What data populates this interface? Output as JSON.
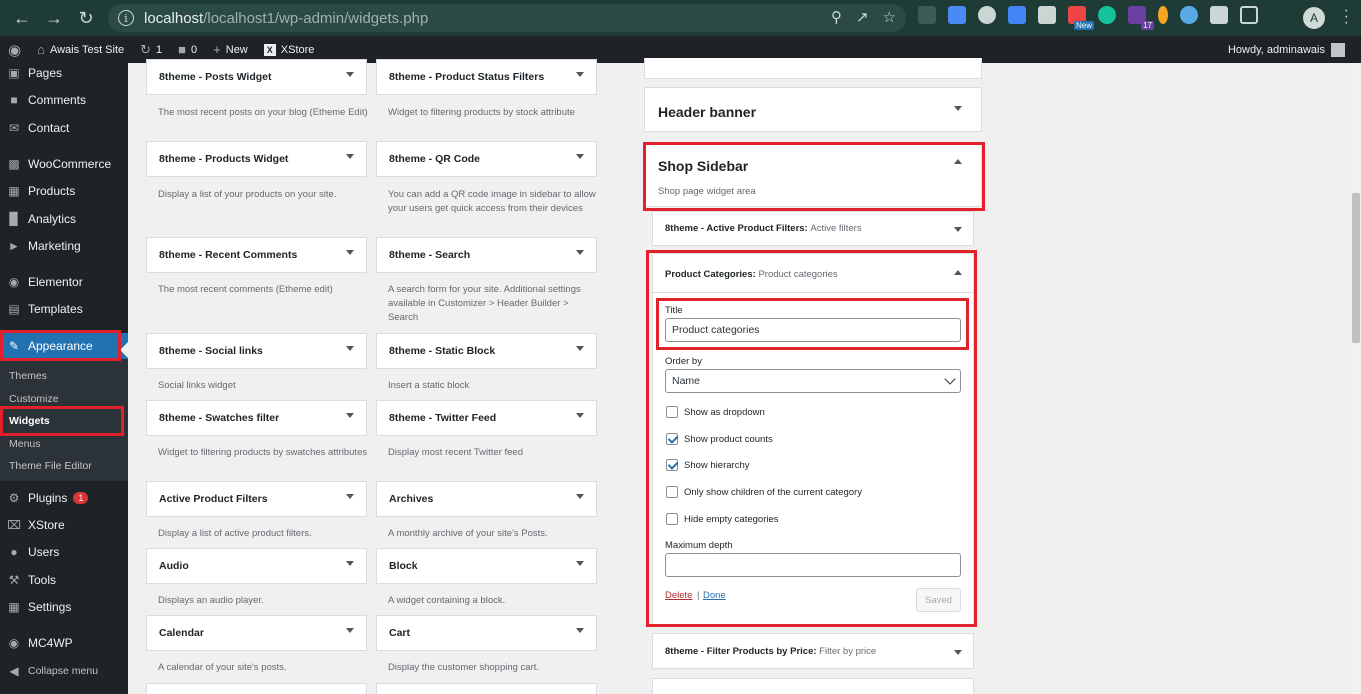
{
  "browser": {
    "url_host": "localhost",
    "url_path": "/localhost1/wp-admin/widgets.php",
    "profile_initial": "A",
    "ext_badges": {
      "new": "New",
      "count": "17"
    }
  },
  "adminbar": {
    "site_name": "Awais Test Site",
    "updates": "1",
    "comments": "0",
    "new_label": "New",
    "xstore": "XStore",
    "howdy": "Howdy, adminawais"
  },
  "sidebar": {
    "pages": "Pages",
    "comments": "Comments",
    "contact": "Contact",
    "woocommerce": "WooCommerce",
    "products": "Products",
    "analytics": "Analytics",
    "marketing": "Marketing",
    "elementor": "Elementor",
    "templates": "Templates",
    "appearance": "Appearance",
    "sub": {
      "themes": "Themes",
      "customize": "Customize",
      "widgets": "Widgets",
      "menus": "Menus",
      "theme_file_editor": "Theme File Editor"
    },
    "plugins": "Plugins",
    "plugins_badge": "1",
    "xstore": "XStore",
    "users": "Users",
    "tools": "Tools",
    "settings": "Settings",
    "mc4wp": "MC4WP",
    "collapse": "Collapse menu"
  },
  "widgets": [
    {
      "name": "8theme - Posts Widget",
      "desc": "The most recent posts on your blog (Etheme Edit)"
    },
    {
      "name": "8theme - Product Status Filters",
      "desc": "Widget to filtering products by stock attribute"
    },
    {
      "name": "8theme - Products Widget",
      "desc": "Display a list of your products on your site."
    },
    {
      "name": "8theme - QR Code",
      "desc": "You can add a QR code image in sidebar to allow your users get quick access from their devices"
    },
    {
      "name": "8theme - Recent Comments",
      "desc": "The most recent comments (Etheme edit)"
    },
    {
      "name": "8theme - Search",
      "desc": "A search form for your site. Additional settings available in Customizer > Header Builder > Search"
    },
    {
      "name": "8theme - Social links",
      "desc": "Social links widget"
    },
    {
      "name": "8theme - Static Block",
      "desc": "Insert a static block"
    },
    {
      "name": "8theme - Swatches filter",
      "desc": "Widget to filtering products by swatches attributes"
    },
    {
      "name": "8theme - Twitter Feed",
      "desc": "Display most recent Twitter feed"
    },
    {
      "name": "Active Product Filters",
      "desc": "Display a list of active product filters."
    },
    {
      "name": "Archives",
      "desc": "A monthly archive of your site's Posts."
    },
    {
      "name": "Audio",
      "desc": "Displays an audio player."
    },
    {
      "name": "Block",
      "desc": "A widget containing a block."
    },
    {
      "name": "Calendar",
      "desc": "A calendar of your site's posts."
    },
    {
      "name": "Cart",
      "desc": "Display the customer shopping cart."
    }
  ],
  "areas": {
    "header_banner": "Header banner",
    "shop_sidebar": "Shop Sidebar",
    "shop_sidebar_desc": "Shop page widget area"
  },
  "active_filters": {
    "name": "8theme - Active Product Filters:",
    "title": "Active filters"
  },
  "categories_widget": {
    "name": "Product Categories:",
    "title": "Product categories",
    "title_label": "Title",
    "title_value": "Product categories",
    "order_label": "Order by",
    "order_value": "Name",
    "cb_dropdown": "Show as dropdown",
    "cb_counts": "Show product counts",
    "cb_hierarchy": "Show hierarchy",
    "cb_children": "Only show children of the current category",
    "cb_hide_empty": "Hide empty categories",
    "max_depth_label": "Maximum depth",
    "delete": "Delete",
    "done": "Done",
    "saved": "Saved"
  },
  "price_filter": {
    "name": "8theme - Filter Products by Price:",
    "title": "Filter by price"
  }
}
